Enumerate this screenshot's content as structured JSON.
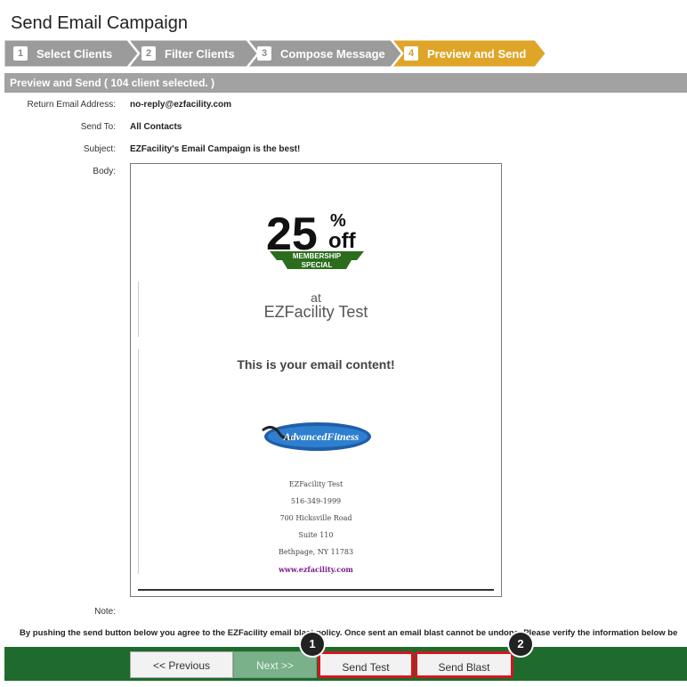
{
  "page_title": "Send Email Campaign",
  "wizard": {
    "steps": [
      {
        "num": "1",
        "label": "Select Clients"
      },
      {
        "num": "2",
        "label": "Filter Clients"
      },
      {
        "num": "3",
        "label": "Compose Message"
      },
      {
        "num": "4",
        "label": "Preview and Send"
      }
    ],
    "active_step": 4
  },
  "section_title": "Preview and Send ( 104 client selected. )",
  "fields": {
    "return_label": "Return Email Address:",
    "return_value": "no-reply@ezfacility.com",
    "sendto_label": "Send To:",
    "sendto_value": "All Contacts",
    "subject_label": "Subject:",
    "subject_value": "EZFacility's Email Campaign is the best!",
    "body_label": "Body:",
    "note_label": "Note:"
  },
  "preview": {
    "promo": {
      "big": "25",
      "percent": "%",
      "off": "off",
      "banner1": "MEMBERSHIP",
      "banner2": "SPECIAL"
    },
    "at": "at",
    "company": "EZFacility Test",
    "content": "This is your email content!",
    "logo_text": "AdvancedFitness",
    "address": [
      "EZFacility Test",
      "516-349-1999",
      "700 Hicksville Road",
      "Suite 110",
      "Bethpage, NY 11783"
    ],
    "website": "www.ezfacility.com"
  },
  "agreement": "By pushing the send button below you agree to the EZFacility email blast policy. Once sent an email blast cannot be undone. Please verify the information below be",
  "buttons": {
    "previous": "<< Previous",
    "next": "Next >>",
    "send_test": "Send Test",
    "send_blast": "Send Blast"
  },
  "callouts": [
    "1",
    "2"
  ],
  "colors": {
    "step_inactive": "#9b9b9b",
    "step_active": "#dfa528",
    "section_bar": "#a2a2a2",
    "footer": "#1e6b2d",
    "highlight": "#d8141c",
    "link": "#7a1a8a"
  }
}
